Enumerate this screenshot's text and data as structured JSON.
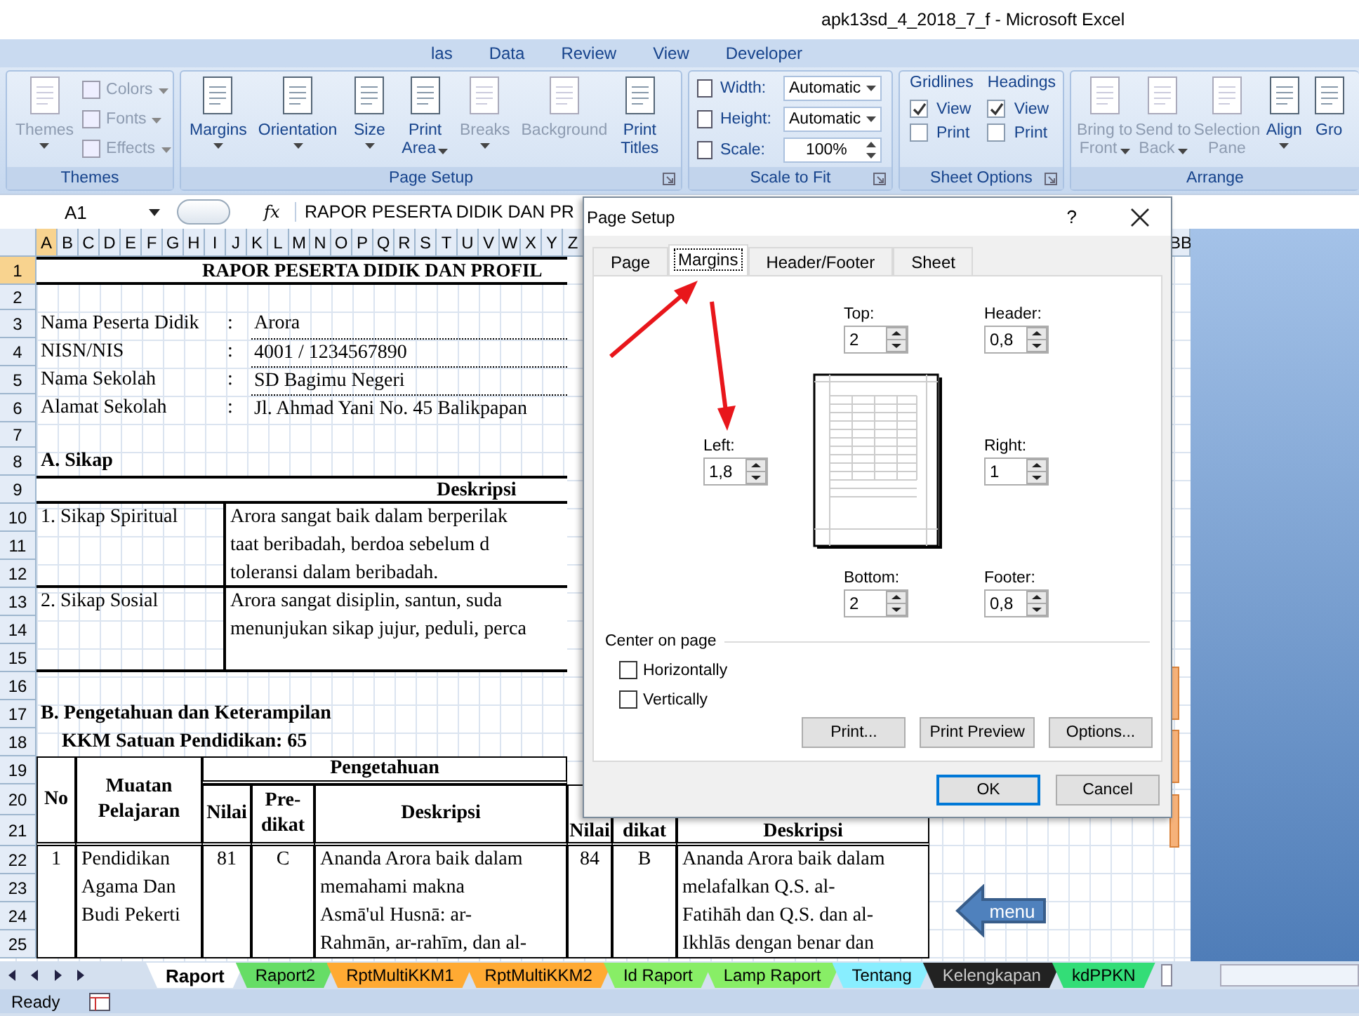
{
  "window": {
    "title": "apk13sd_4_2018_7_f - Microsoft Excel"
  },
  "ribbon_tabs": [
    {
      "label": "las"
    },
    {
      "label": "Data"
    },
    {
      "label": "Review"
    },
    {
      "label": "View"
    },
    {
      "label": "Developer"
    }
  ],
  "ribbon_groups": [
    {
      "label": "Themes",
      "launcher": false,
      "items": [
        {
          "kind": "large",
          "lines": [
            "Themes"
          ],
          "dropdown": true,
          "disabled": true
        },
        {
          "kind": "stack",
          "entries": [
            {
              "label": "Colors",
              "dropdown": true,
              "disabled": true
            },
            {
              "label": "Fonts",
              "dropdown": true,
              "disabled": true
            },
            {
              "label": "Effects",
              "dropdown": true,
              "disabled": true
            }
          ]
        }
      ]
    },
    {
      "label": "Page Setup",
      "launcher": true,
      "items": [
        {
          "kind": "large",
          "lines": [
            "Margins"
          ],
          "dropdown": true,
          "disabled": false
        },
        {
          "kind": "large",
          "lines": [
            "Orientation"
          ],
          "dropdown": true,
          "disabled": false
        },
        {
          "kind": "large",
          "lines": [
            "Size"
          ],
          "dropdown": true,
          "disabled": false
        },
        {
          "kind": "large",
          "lines": [
            "Print",
            "Area"
          ],
          "dropdown": true,
          "disabled": false
        },
        {
          "kind": "large",
          "lines": [
            "Breaks"
          ],
          "dropdown": true,
          "disabled": true
        },
        {
          "kind": "large",
          "lines": [
            "Background"
          ],
          "dropdown": false,
          "disabled": true
        },
        {
          "kind": "large",
          "lines": [
            "Print",
            "Titles"
          ],
          "dropdown": false,
          "disabled": false
        }
      ]
    },
    {
      "label": "Scale to Fit",
      "launcher": true,
      "items": [
        {
          "kind": "scale",
          "entries": [
            {
              "label": "Width:",
              "value": "Automatic",
              "kind": "dropdown"
            },
            {
              "label": "Height:",
              "value": "Automatic",
              "kind": "dropdown"
            },
            {
              "label": "Scale:",
              "value": "100%",
              "kind": "spinner"
            }
          ]
        }
      ]
    },
    {
      "label": "Sheet Options",
      "launcher": true,
      "items": [
        {
          "kind": "checks",
          "title": "Gridlines",
          "entries": [
            {
              "label": "View",
              "checked": true
            },
            {
              "label": "Print",
              "checked": false
            }
          ]
        },
        {
          "kind": "checks",
          "title": "Headings",
          "entries": [
            {
              "label": "View",
              "checked": true
            },
            {
              "label": "Print",
              "checked": false
            }
          ]
        }
      ]
    },
    {
      "label": "Arrange",
      "launcher": false,
      "items": [
        {
          "kind": "large",
          "lines": [
            "Bring to",
            "Front"
          ],
          "dropdown": true,
          "disabled": true
        },
        {
          "kind": "large",
          "lines": [
            "Send to",
            "Back"
          ],
          "dropdown": true,
          "disabled": true
        },
        {
          "kind": "large",
          "lines": [
            "Selection",
            "Pane"
          ],
          "dropdown": false,
          "disabled": true
        },
        {
          "kind": "large",
          "lines": [
            "Align"
          ],
          "dropdown": true,
          "disabled": false
        },
        {
          "kind": "large",
          "lines": [
            "Gro"
          ],
          "dropdown": false,
          "disabled": false
        }
      ]
    }
  ],
  "formula_bar": {
    "name_box": "A1",
    "fx": "fx",
    "content": "RAPOR PESERTA DIDIK DAN PR"
  },
  "column_headers": [
    {
      "label": "A",
      "selected": true
    },
    {
      "label": "B",
      "selected": false
    },
    {
      "label": "C",
      "selected": false
    },
    {
      "label": "D",
      "selected": false
    },
    {
      "label": "E",
      "selected": false
    },
    {
      "label": "F",
      "selected": false
    },
    {
      "label": "G",
      "selected": false
    },
    {
      "label": "H",
      "selected": false
    },
    {
      "label": "I",
      "selected": false
    },
    {
      "label": "J",
      "selected": false
    },
    {
      "label": "K",
      "selected": false
    },
    {
      "label": "L",
      "selected": false
    },
    {
      "label": "M",
      "selected": false
    },
    {
      "label": "N",
      "selected": false
    },
    {
      "label": "O",
      "selected": false
    },
    {
      "label": "P",
      "selected": false
    },
    {
      "label": "Q",
      "selected": false
    },
    {
      "label": "R",
      "selected": false
    },
    {
      "label": "S",
      "selected": false
    },
    {
      "label": "T",
      "selected": false
    },
    {
      "label": "U",
      "selected": false
    },
    {
      "label": "V",
      "selected": false
    },
    {
      "label": "W",
      "selected": false
    },
    {
      "label": "X",
      "selected": false
    },
    {
      "label": "Y",
      "selected": false
    },
    {
      "label": "Z",
      "selected": false
    }
  ],
  "far_column_header": "BB",
  "row_headers": [
    {
      "label": "1",
      "selected": true
    },
    {
      "label": "2",
      "selected": false
    },
    {
      "label": "3",
      "selected": false
    },
    {
      "label": "4",
      "selected": false
    },
    {
      "label": "5",
      "selected": false
    },
    {
      "label": "6",
      "selected": false
    },
    {
      "label": "7",
      "selected": false
    },
    {
      "label": "8",
      "selected": false
    },
    {
      "label": "9",
      "selected": false
    },
    {
      "label": "10",
      "selected": false
    },
    {
      "label": "11",
      "selected": false
    },
    {
      "label": "12",
      "selected": false
    },
    {
      "label": "13",
      "selected": false
    },
    {
      "label": "14",
      "selected": false
    },
    {
      "label": "15",
      "selected": false
    },
    {
      "label": "16",
      "selected": false
    },
    {
      "label": "17",
      "selected": false
    },
    {
      "label": "18",
      "selected": false
    },
    {
      "label": "19",
      "selected": false
    },
    {
      "label": "20",
      "selected": false
    },
    {
      "label": "21",
      "selected": false
    },
    {
      "label": "22",
      "selected": false
    },
    {
      "label": "23",
      "selected": false
    },
    {
      "label": "24",
      "selected": false
    },
    {
      "label": "25",
      "selected": false
    }
  ],
  "sheet": {
    "title": "RAPOR PESERTA DIDIK DAN PROFIL",
    "identity": [
      {
        "label": "Nama Peserta Didik",
        "colon": ":",
        "value": "Arora"
      },
      {
        "label": "NISN/NIS",
        "colon": ":",
        "value": "4001 / 1234567890"
      },
      {
        "label": "Nama Sekolah",
        "colon": ":",
        "value": "SD Bagimu Negeri"
      },
      {
        "label": "Alamat Sekolah",
        "colon": ":",
        "value": "Jl. Ahmad Yani No. 45 Balikpapan"
      }
    ],
    "section_a": "A. Sikap",
    "sikap_header": "Deskripsi",
    "sikap": [
      {
        "label": "1. Sikap Spiritual",
        "lines": [
          "Arora sangat baik dalam  berperilak",
          "taat beribadah, berdoa sebelum d",
          "toleransi dalam beribadah."
        ]
      },
      {
        "label": "2. Sikap Sosial",
        "lines": [
          "Arora sangat disiplin, santun, suda",
          "menunjukan sikap jujur, peduli, perca"
        ]
      }
    ],
    "section_b": "B. Pengetahuan dan Keterampilan",
    "kkm": "KKM Satuan Pendidikan: 65",
    "table": {
      "headers": {
        "no": "No",
        "subject": [
          "Muatan",
          "Pelajaran"
        ],
        "group": "Pengetahuan",
        "score": "Nilai",
        "predicate": [
          "Pre-",
          "dikat"
        ],
        "description": "Deskripsi",
        "score_2": "Nilai",
        "predicate_2": "dikat",
        "description_2": "Deskripsi"
      },
      "rows": [
        {
          "no": "1",
          "subject": [
            "Pendidikan",
            "Agama Dan",
            "Budi Pekerti"
          ],
          "score": "81",
          "predicate": "C",
          "description": [
            "Ananda Arora baik dalam",
            "memahami makna",
            "Asmā'ul Husnā: ar-",
            "Rahmān, ar-rahīm, dan al-"
          ],
          "score_2": "84",
          "predicate_2": "B",
          "description_2": [
            "Ananda Arora baik dalam",
            "melafalkan Q.S. al-",
            "Fatihāh dan Q.S. dan al-",
            "Ikhlās dengan benar dan"
          ]
        }
      ]
    }
  },
  "menu_shape": {
    "label": "menu"
  },
  "sheet_tabs": [
    {
      "label": "Raport",
      "selected": true,
      "color": "#ffffff"
    },
    {
      "label": "Raport2",
      "selected": false,
      "color": "#66dd66"
    },
    {
      "label": "RptMultiKKM1",
      "selected": false,
      "color": "#ffaa33"
    },
    {
      "label": "RptMultiKKM2",
      "selected": false,
      "color": "#ffaa33"
    },
    {
      "label": "Id Raport",
      "selected": false,
      "color": "#88ee66"
    },
    {
      "label": "Lamp Raport",
      "selected": false,
      "color": "#88ee66"
    },
    {
      "label": "Tentang",
      "selected": false,
      "color": "#88eeff"
    },
    {
      "label": "Kelengkapan",
      "selected": false,
      "color": "#222222"
    },
    {
      "label": "kdPPKN",
      "selected": false,
      "color": "#33dd77"
    }
  ],
  "status_bar": {
    "text": "Ready"
  },
  "dialog": {
    "title": "Page Setup",
    "help": "?",
    "tabs": [
      {
        "label": "Page",
        "selected": false
      },
      {
        "label": "Margins",
        "selected": true
      },
      {
        "label": "Header/Footer",
        "selected": false
      },
      {
        "label": "Sheet",
        "selected": false
      }
    ],
    "fields": [
      {
        "label": "Top:",
        "value": "2"
      },
      {
        "label": "Header:",
        "value": "0,8"
      },
      {
        "label": "Left:",
        "value": "1,8"
      },
      {
        "label": "Right:",
        "value": "1"
      },
      {
        "label": "Bottom:",
        "value": "2"
      },
      {
        "label": "Footer:",
        "value": "0,8"
      }
    ],
    "center_group": {
      "title": "Center on page",
      "options": [
        {
          "label": "Horizontally",
          "checked": false
        },
        {
          "label": "Vertically",
          "checked": false
        }
      ]
    },
    "panel_buttons": [
      {
        "label": "Print..."
      },
      {
        "label": "Print Preview"
      },
      {
        "label": "Options..."
      }
    ],
    "footer_buttons": [
      {
        "label": "OK",
        "default": true
      },
      {
        "label": "Cancel",
        "default": false
      }
    ]
  }
}
